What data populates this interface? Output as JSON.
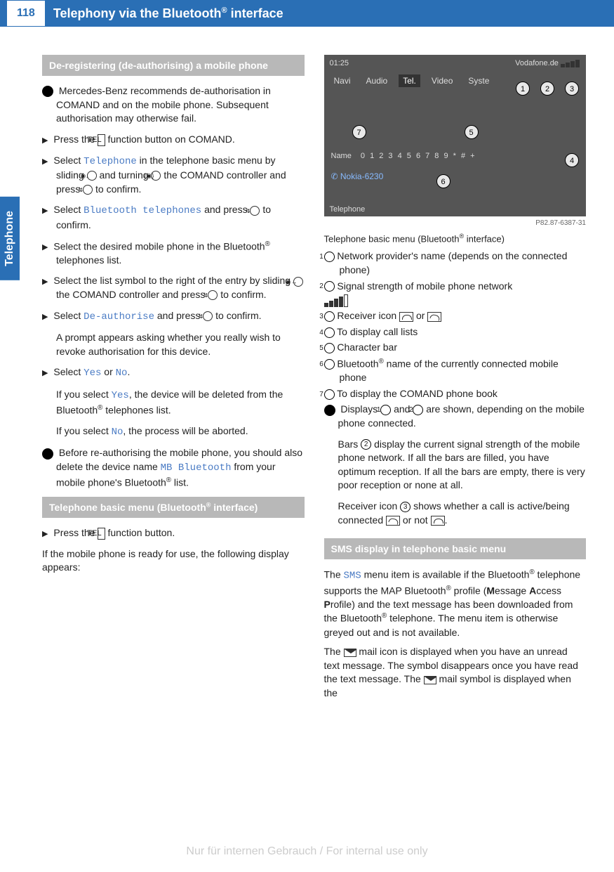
{
  "page_number": "118",
  "header_title": "Telephony via the Bluetooth",
  "header_title_sup": "®",
  "header_title_tail": " interface",
  "side_tab": "Telephone",
  "left": {
    "hdr1": "De-registering (de-authorising) a mobile phone",
    "info1": "Mercedes-Benz recommends de-authorisation in COMAND and on the mobile phone. Subsequent authorisation may otherwise fail.",
    "step1_pre": "Press the ",
    "tel_key": "TEL",
    "step1_post": " function button on COMAND.",
    "step2_pre": "Select ",
    "step2_mono": "Telephone",
    "step2_post": " in the telephone basic menu by sliding ",
    "step2_mid": " and turning ",
    "step2_tail": " the COMAND controller and press ",
    "step2_end": " to confirm.",
    "step3_pre": "Select ",
    "step3_mono": "Bluetooth telephones",
    "step3_post": " and press ",
    "step3_end": " to confirm.",
    "step4": "Select the desired mobile phone in the Bluetooth",
    "step4_tail": " telephones list.",
    "step5_pre": "Select the list symbol to the right of the entry by sliding ",
    "step5_mid": " the COMAND controller and press ",
    "step5_end": " to confirm.",
    "step6_pre": "Select ",
    "step6_mono": "De-authorise",
    "step6_post": " and press ",
    "step6_end": " to confirm.",
    "step6_body": "A prompt appears asking whether you really wish to revoke authorisation for this device.",
    "step7_pre": "Select ",
    "step7_yes": "Yes",
    "step7_or": " or ",
    "step7_no": "No",
    "step7_dot": ".",
    "step7_body1_pre": "If you select ",
    "step7_body1_post": ", the device will be deleted from the Bluetooth",
    "step7_body1_tail": " telephones list.",
    "step7_body2_pre": "If you select ",
    "step7_body2_post": ", the process will be aborted.",
    "info2_pre": "Before re-authorising the mobile phone, you should also delete the device name ",
    "info2_mono": "MB Bluetooth",
    "info2_post": " from your mobile phone's Bluetooth",
    "info2_tail": " list.",
    "hdr2_pre": "Telephone basic menu (Bluetooth",
    "hdr2_sup": "®",
    "hdr2_post": " interface)",
    "step8_pre": "Press the ",
    "step8_post": " function button.",
    "para9": "If the mobile phone is ready for use, the following display appears:"
  },
  "right": {
    "scr_time": "01:25",
    "scr_provider": "Vodafone.de",
    "scr_navi": "Navi",
    "scr_audio": "Audio",
    "scr_tel": "Tel.",
    "scr_video": "Video",
    "scr_syste": "Syste",
    "scr_name": "Name",
    "scr_digits": "0 1 2 3 4 5 6 7 8 9 * # +",
    "scr_phone": "Nokia-6230",
    "scr_bottom": "Telephone",
    "img_ref": "P82.87-6387-31",
    "caption_pre": "Telephone basic menu (Bluetooth",
    "caption_sup": "®",
    "caption_post": " interface)",
    "leg1": "Network provider's name (depends on the connected phone)",
    "leg2": "Signal strength of mobile phone network",
    "leg3_pre": "Receiver icon ",
    "leg3_or": " or ",
    "leg4": "To display call lists",
    "leg5": "Character bar",
    "leg6_pre": "Bluetooth",
    "leg6_post": " name of the currently connected mobile phone",
    "leg7": "To display the COMAND phone book",
    "info3_pre": "Displays ",
    "info3_and": " and ",
    "info3_post": " are shown, depending on the mobile phone connected.",
    "info3_b2_pre": "Bars ",
    "info3_b2_post": " display the current signal strength of the mobile phone network. If all the bars are filled, you have optimum reception. If all the bars are empty, there is very poor reception or none at all.",
    "info3_b3_pre": "Receiver icon ",
    "info3_b3_post": " shows whether a call is active/being connected ",
    "info3_b3_or": " or not ",
    "info3_b3_dot": ".",
    "hdr3": "SMS display in telephone basic menu",
    "sms_pre": "The ",
    "sms_mono": "SMS",
    "sms_post": " menu item is available if the Bluetooth",
    "sms_mid": " telephone supports the MAP Bluetooth",
    "sms_tail": " profile (",
    "sms_bM": "M",
    "sms_t1": "essage ",
    "sms_bA": "A",
    "sms_t2": "ccess ",
    "sms_bP": "P",
    "sms_t3": "rofile) and the text message has been downloaded from the Bluetooth",
    "sms_t4": " telephone. The menu item is otherwise greyed out and is not available.",
    "sms_p2_pre": "The ",
    "sms_p2_post": " mail icon is displayed when you have an unread text message. The symbol disappears once you have read the text message. The ",
    "sms_p2_tail": " mail symbol is displayed when the"
  },
  "watermark": "Nur für internen Gebrauch / For internal use only"
}
